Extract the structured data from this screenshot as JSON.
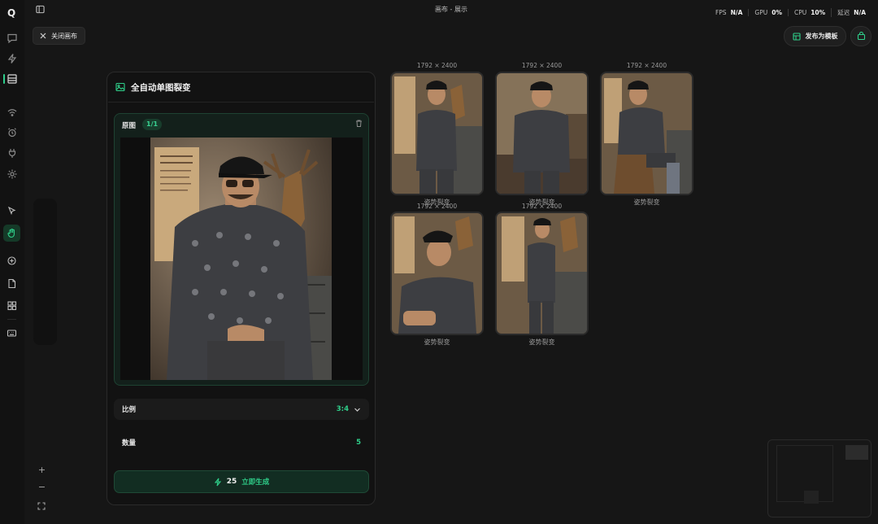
{
  "app": {
    "logo": "Q",
    "title": "画布 - 展示"
  },
  "stats": [
    {
      "label": "FPS",
      "value": "N/A"
    },
    {
      "label": "GPU",
      "value": "0%"
    },
    {
      "label": "CPU",
      "value": "10%"
    },
    {
      "label": "延迟",
      "value": "N/A"
    }
  ],
  "toolbar": {
    "close_label": "关闭画布",
    "publish_label": "发布为模板"
  },
  "card": {
    "title": "全自动单图裂变",
    "source_label": "原图",
    "source_count": "1/1",
    "ratio_label": "比例",
    "ratio_value": "3:4",
    "quantity_label": "数量",
    "quantity_value": "5",
    "generate_cost": "25",
    "generate_label": "立即生成"
  },
  "outputs": [
    {
      "dims": "1792 × 2400",
      "caption": "姿势裂变"
    },
    {
      "dims": "1792 × 2400",
      "caption": "姿势裂变"
    },
    {
      "dims": "1792 × 2400",
      "caption": "姿势裂变"
    },
    {
      "dims": "1792 × 2400",
      "caption": "姿势裂变"
    },
    {
      "dims": "1792 × 2400",
      "caption": "姿势裂变"
    }
  ],
  "colors": {
    "accent": "#2fcf8a",
    "background": "#161616",
    "panel": "#121212"
  }
}
